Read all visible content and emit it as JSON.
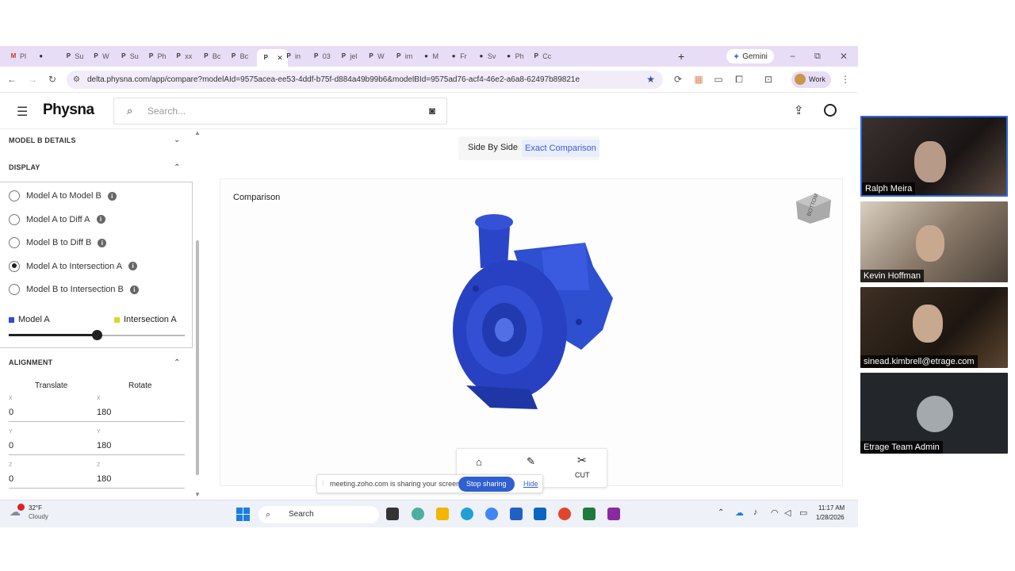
{
  "browser": {
    "tabs": [
      {
        "label": "Pl",
        "icon": "gmail-icon"
      },
      {
        "label": "",
        "icon": "tab-icon"
      },
      {
        "label": "Su",
        "icon": "physna-tab-icon"
      },
      {
        "label": "W",
        "icon": "physna-tab-icon"
      },
      {
        "label": "Su",
        "icon": "physna-tab-icon"
      },
      {
        "label": "Ph",
        "icon": "physna-tab-icon"
      },
      {
        "label": "xx",
        "icon": "physna-tab-icon"
      },
      {
        "label": "Bc",
        "icon": "physna-tab-icon"
      },
      {
        "label": "Bc",
        "icon": "physna-tab-icon"
      },
      {
        "label": "",
        "icon": "physna-tab-icon"
      },
      {
        "label": "in",
        "icon": "physna-tab-icon"
      },
      {
        "label": "03",
        "icon": "physna-tab-icon"
      },
      {
        "label": "jel",
        "icon": "physna-tab-icon"
      },
      {
        "label": "W",
        "icon": "physna-tab-icon"
      },
      {
        "label": "im",
        "icon": "physna-tab-icon"
      },
      {
        "label": "M",
        "icon": "tab-icon"
      },
      {
        "label": "Fr",
        "icon": "tab-icon"
      },
      {
        "label": "Sv",
        "icon": "tab-icon"
      },
      {
        "label": "Ph",
        "icon": "tab-icon"
      },
      {
        "label": "Cc",
        "icon": "physna-tab-icon"
      }
    ],
    "gemini_label": "Gemini",
    "url": "delta.physna.com/app/compare?modelAId=9575acea-ee53-4ddf-b75f-d884a49b99b6&modelBId=9575ad76-acf4-46e2-a6a8-62497b89821e",
    "profile_label": "Work"
  },
  "app": {
    "logo": "Physna",
    "search_placeholder": "Search..."
  },
  "left_panel": {
    "model_b_details": "MODEL B DETAILS",
    "display": "DISPLAY",
    "options": [
      {
        "label": "Model A to Model B",
        "selected": false
      },
      {
        "label": "Model A to Diff A",
        "selected": false
      },
      {
        "label": "Model B to Diff B",
        "selected": false
      },
      {
        "label": "Model A to Intersection A",
        "selected": true
      },
      {
        "label": "Model B to Intersection B",
        "selected": false
      }
    ],
    "legend_a": "Model A",
    "legend_b": "Intersection A",
    "slider_position": 0.5,
    "alignment": "ALIGNMENT",
    "translate": "Translate",
    "rotate": "Rotate",
    "axes": [
      {
        "axis": "X",
        "translate": "0",
        "rotate": "180"
      },
      {
        "axis": "Y",
        "translate": "0",
        "rotate": "180"
      },
      {
        "axis": "Z",
        "translate": "0",
        "rotate": "180"
      }
    ]
  },
  "viewer": {
    "side_by_side": "Side By Side",
    "exact_comparison": "Exact Comparison",
    "panel_title": "Comparison",
    "cut_label": "CUT",
    "colors": {
      "model_a": "#2d4fd0",
      "intersection": "#e6d22a",
      "accent": "#3b5bdb"
    }
  },
  "share_bar": {
    "message": "meeting.zoho.com is sharing your screen.",
    "stop": "Stop sharing",
    "hide": "Hide"
  },
  "taskbar": {
    "temp": "32°F",
    "weather": "Cloudy",
    "search": "Search",
    "time": "11:17 AM",
    "date": "1/28/2026"
  },
  "participants": [
    "Ralph Meira",
    "Kevin Hoffman",
    "sinead.kimbrell@etrage.com",
    "Etrage Team Admin"
  ]
}
